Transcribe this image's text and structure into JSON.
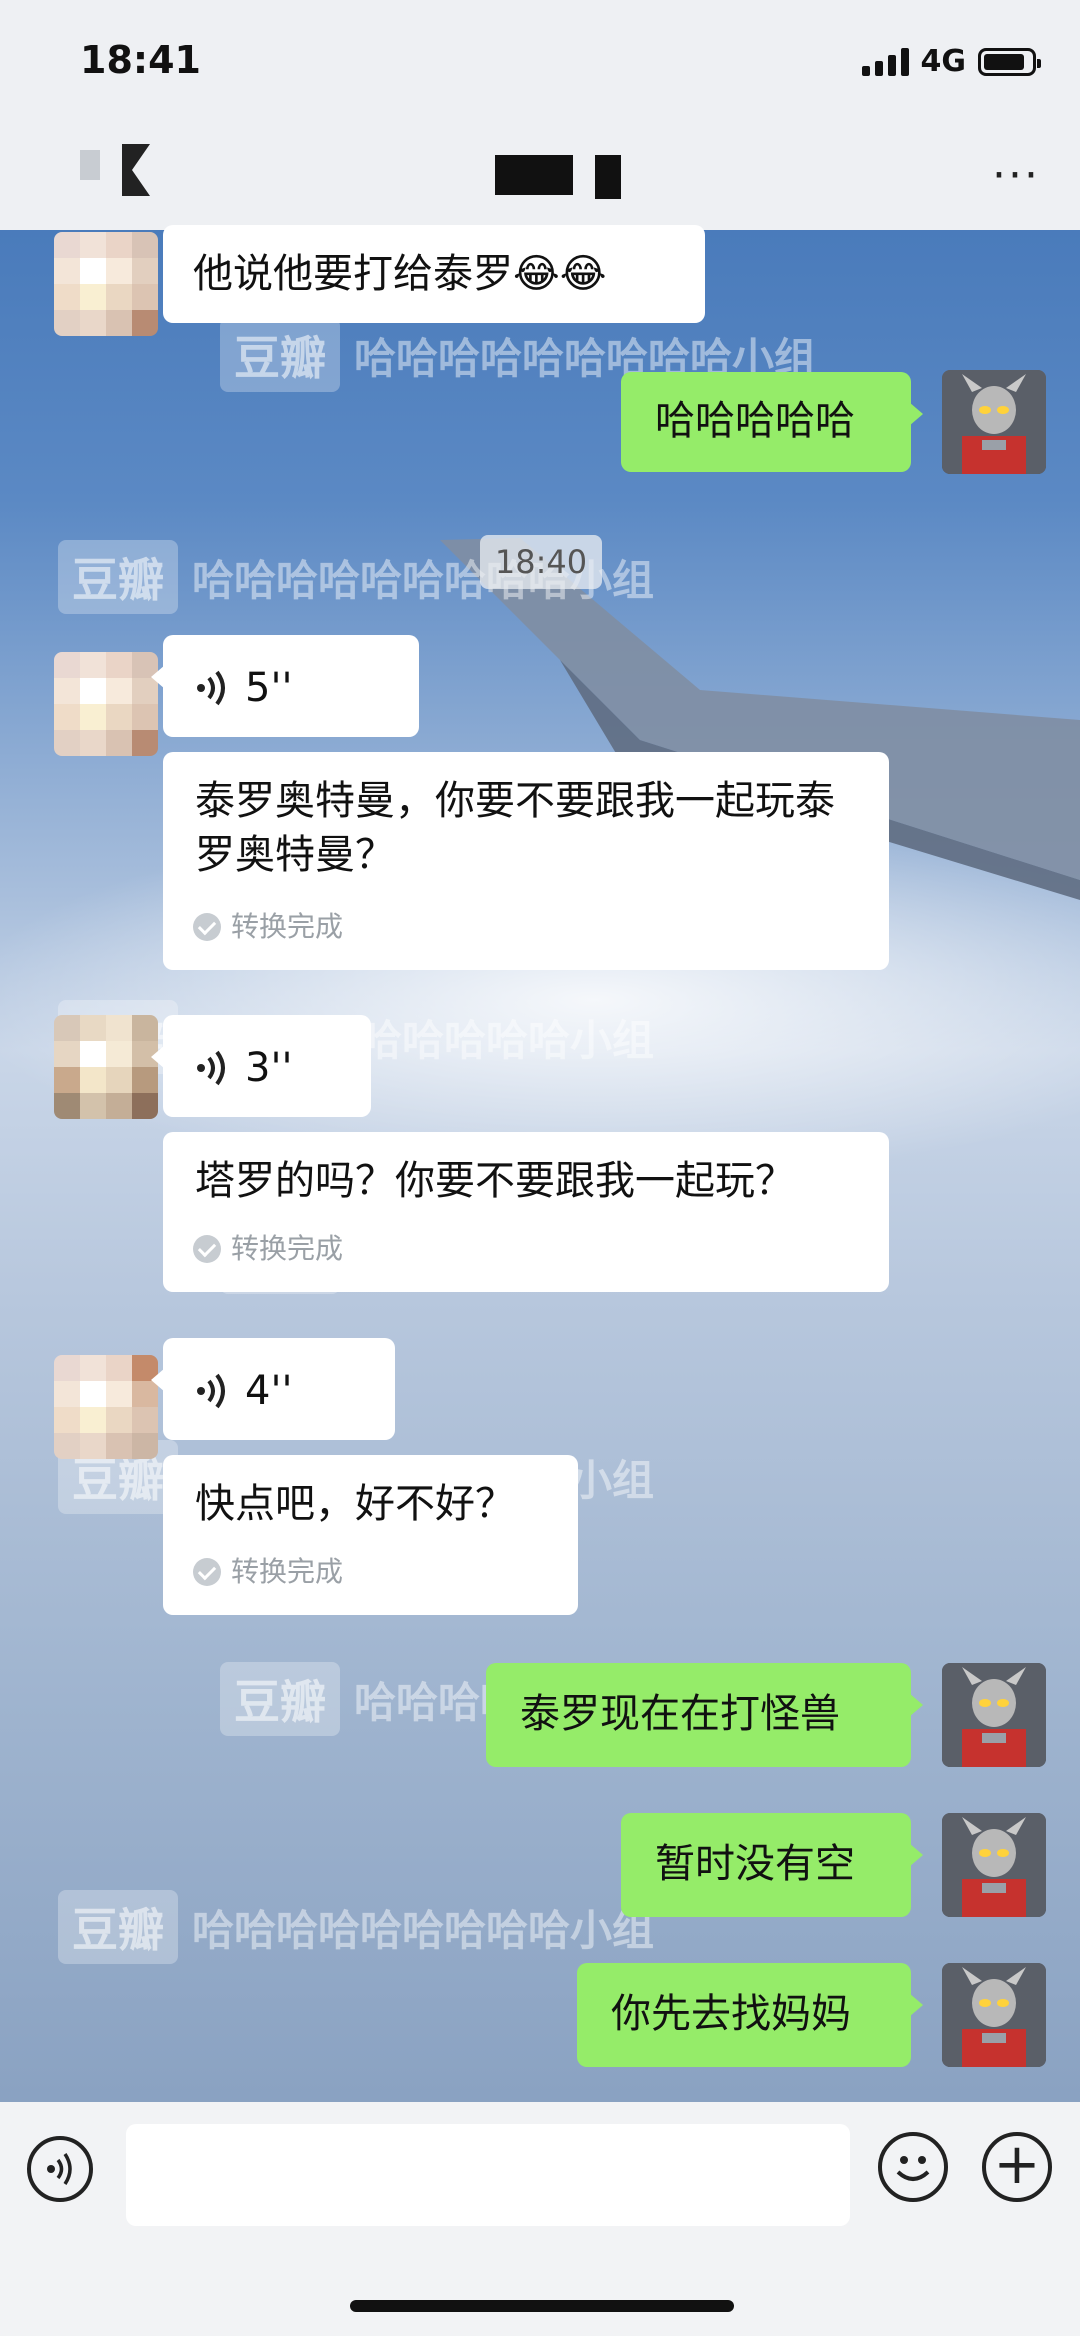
{
  "status_bar": {
    "time": "18:41",
    "network": "4G"
  },
  "nav_bar": {
    "more_icon": "···"
  },
  "watermark": {
    "brand": "豆瓣",
    "group": "哈哈哈哈哈哈哈哈哈小组"
  },
  "timestamp": "18:40",
  "messages": [
    {
      "side": "left",
      "type": "text",
      "text": "他说他要打给泰罗😂😂"
    },
    {
      "side": "right",
      "type": "text",
      "text": "哈哈哈哈哈"
    },
    {
      "side": "left",
      "type": "voice",
      "duration": "5''"
    },
    {
      "side": "left",
      "type": "transcript",
      "text": "泰罗奥特曼，你要不要跟我一起玩泰罗奥特曼？",
      "status": "转换完成"
    },
    {
      "side": "left",
      "type": "voice",
      "duration": "3''"
    },
    {
      "side": "left",
      "type": "transcript",
      "text": "塔罗的吗？你要不要跟我一起玩？",
      "status": "转换完成"
    },
    {
      "side": "left",
      "type": "voice",
      "duration": "4''"
    },
    {
      "side": "left",
      "type": "transcript",
      "text": "快点吧，好不好？",
      "status": "转换完成"
    },
    {
      "side": "right",
      "type": "text",
      "text": "泰罗现在在打怪兽"
    },
    {
      "side": "right",
      "type": "text",
      "text": "暂时没有空"
    },
    {
      "side": "right",
      "type": "text",
      "text": "你先去找妈妈"
    }
  ],
  "input_bar": {
    "placeholder": "",
    "plus_icon": "+"
  },
  "colors": {
    "self_bubble": "#95ec69",
    "other_bubble": "#ffffff",
    "bar_bg": "#f2f3f5"
  }
}
